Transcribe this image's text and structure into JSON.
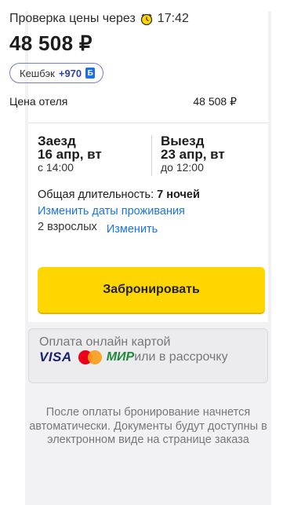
{
  "header": {
    "check_label": "Проверка цены через",
    "timer_value": "17:42",
    "total_price": "48 508 ₽"
  },
  "cashback": {
    "label": "Кешбэк",
    "amount": "+970"
  },
  "hotel_price": {
    "label": "Цена отеля",
    "value": "48 508 ₽"
  },
  "checkin": {
    "title": "Заезд",
    "date": "16 апр, вт",
    "time": "с 14:00"
  },
  "checkout": {
    "title": "Выезд",
    "date": "23 апр, вт",
    "time": "до 12:00"
  },
  "duration": {
    "label": "Общая длительность:",
    "value": "7 ночей"
  },
  "links": {
    "change_dates": "Изменить даты проживания",
    "change_guests": "Изменить"
  },
  "guests": {
    "text": "2 взрослых"
  },
  "book_button": "Забронировать",
  "payment": {
    "title": "Оплата онлайн картой",
    "visa": "VISA",
    "mir": "МИР",
    "installment": "или в рассрочку"
  },
  "note": "После оплаты бронирование начнется автоматически. Документы будут доступны в электронном виде на странице заказа",
  "colors": {
    "accent_yellow": "#ffd600",
    "link_blue": "#1a73e8"
  }
}
